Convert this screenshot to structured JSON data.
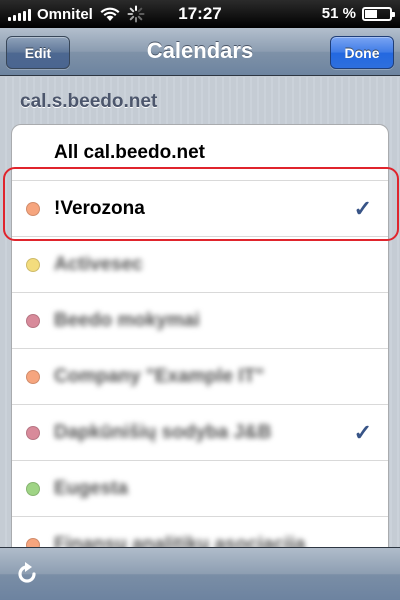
{
  "status_bar": {
    "carrier": "Omnitel",
    "time": "17:27",
    "battery_text": "51 %",
    "battery_level": 0.51
  },
  "nav": {
    "title": "Calendars",
    "left_button": "Edit",
    "right_button": "Done"
  },
  "section": {
    "header": "cal.s.beedo.net"
  },
  "calendars": {
    "all_label": "All cal.beedo.net",
    "items": [
      {
        "label": "!Verozona",
        "color": "#f6a57e",
        "checked": true,
        "blurred": false
      },
      {
        "label": "Activesec",
        "color": "#f3dc7d",
        "checked": false,
        "blurred": true
      },
      {
        "label": "Beedo mokymai",
        "color": "#d88a9a",
        "checked": false,
        "blurred": true
      },
      {
        "label": "Company \"Example IT\"",
        "color": "#f6a57e",
        "checked": false,
        "blurred": true
      },
      {
        "label": "Dapkūnišių sodyba J&B",
        "color": "#d88a9a",
        "checked": true,
        "blurred": true
      },
      {
        "label": "Eugesta",
        "color": "#9fd485",
        "checked": false,
        "blurred": true
      },
      {
        "label": "Finansų analitikų asociacija",
        "color": "#f6a57e",
        "checked": false,
        "blurred": true
      }
    ],
    "check_glyph": "✓"
  },
  "toolbar": {
    "refresh_icon": "refresh-icon"
  }
}
